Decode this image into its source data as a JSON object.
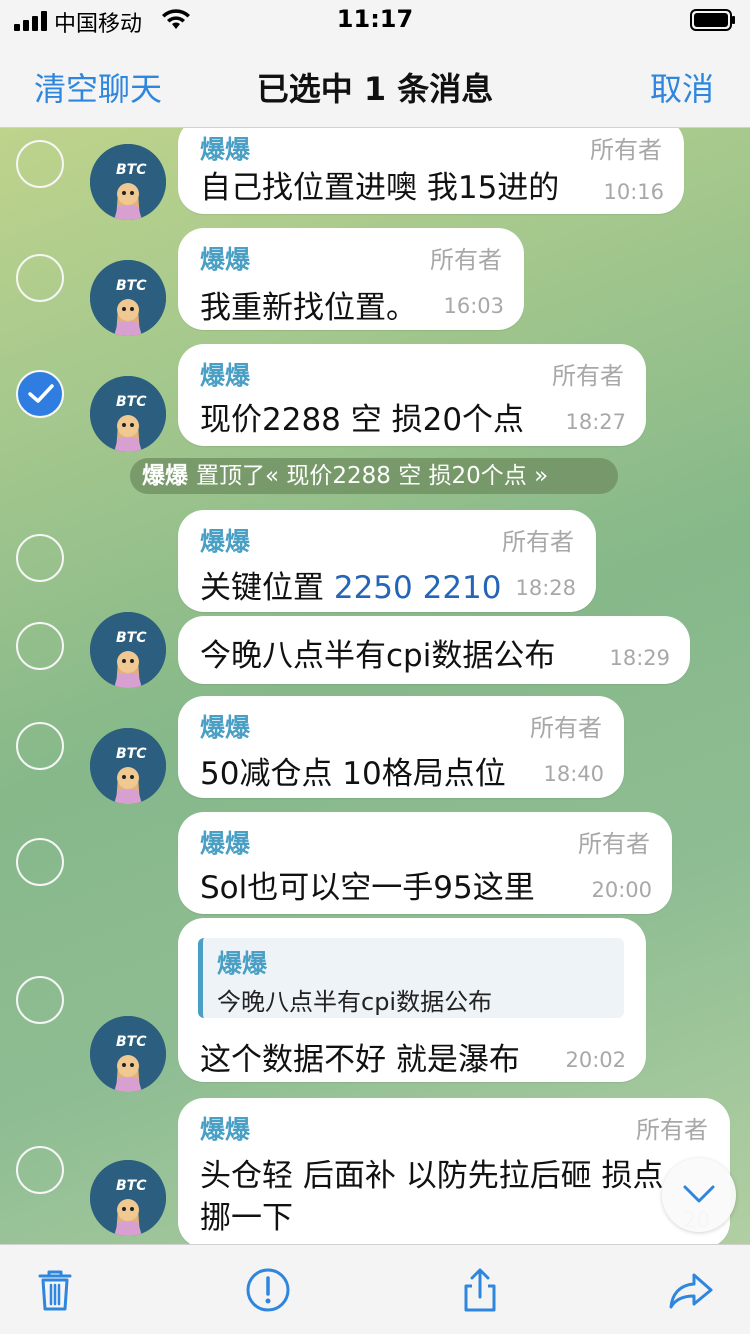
{
  "status_bar": {
    "carrier": "中国移动",
    "time": "11:17"
  },
  "nav": {
    "clear_label": "清空聊天",
    "title": "已选中 1 条消息",
    "cancel_label": "取消"
  },
  "messages": [
    {
      "name": "爆爆",
      "role": "所有者",
      "text": "自己找位置进噢 我15进的",
      "time": "10:16",
      "selected": false
    },
    {
      "name": "爆爆",
      "role": "所有者",
      "text": "我重新找位置。",
      "time": "16:03",
      "selected": false
    },
    {
      "name": "爆爆",
      "role": "所有者",
      "text": "现价2288 空 损20个点",
      "time": "18:27",
      "selected": true
    },
    {
      "name": "爆爆",
      "role": "所有者",
      "text_prefix": "关键位置 ",
      "text_link": "2250 2210",
      "time": "18:28",
      "selected": false
    },
    {
      "text": "今晚八点半有cpi数据公布",
      "time": "18:29",
      "selected": false
    },
    {
      "name": "爆爆",
      "role": "所有者",
      "text": "50减仓点 10格局点位",
      "time": "18:40",
      "selected": false
    },
    {
      "name": "爆爆",
      "role": "所有者",
      "text": "Sol也可以空一手95这里",
      "time": "20:00",
      "selected": false
    },
    {
      "quote_name": "爆爆",
      "quote_text": "今晚八点半有cpi数据公布",
      "text": "这个数据不好 就是瀑布",
      "time": "20:02",
      "selected": false
    },
    {
      "name": "爆爆",
      "role": "所有者",
      "text_line1": "头仓轻 后面补 以防先拉后砸 损点",
      "text_line2": "挪一下",
      "time": "20",
      "selected": false
    }
  ],
  "pinned": {
    "name": "爆爆",
    "text": "置顶了« 现价2288 空 损20个点 »"
  },
  "icons": {
    "trash": "trash-icon",
    "report": "exclamation-icon",
    "share": "share-icon",
    "forward": "forward-icon",
    "scroll": "chevron-down-icon"
  },
  "colors": {
    "accent": "#2e86de",
    "name": "#4a9fc4",
    "link": "#2465b8"
  }
}
